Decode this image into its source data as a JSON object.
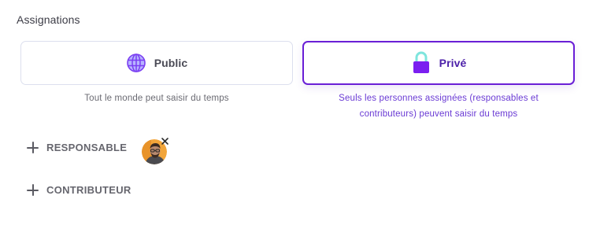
{
  "assignations": {
    "title": "Assignations",
    "options": {
      "public": {
        "label": "Public",
        "icon": "globe-icon",
        "description": "Tout le monde peut saisir du temps"
      },
      "private": {
        "label": "Privé",
        "icon": "lock-icon",
        "selected": true,
        "description_line1": "Seuls les personnes assignées (responsables et",
        "description_line2": "contributeurs) peuvent saisir du temps"
      }
    },
    "roles": {
      "responsable": {
        "label": "RESPONSABLE",
        "assignees": [
          {
            "avatar": "user-avatar"
          }
        ]
      },
      "contributeur": {
        "label": "CONTRIBUTEUR",
        "assignees": []
      }
    }
  },
  "colors": {
    "accent": "#6a1fd6",
    "lock_body": "#7b1ff0",
    "lock_shackle": "#7ee5dd",
    "globe_fill": "#a9a6ff",
    "globe_lines": "#7b3ff2"
  }
}
